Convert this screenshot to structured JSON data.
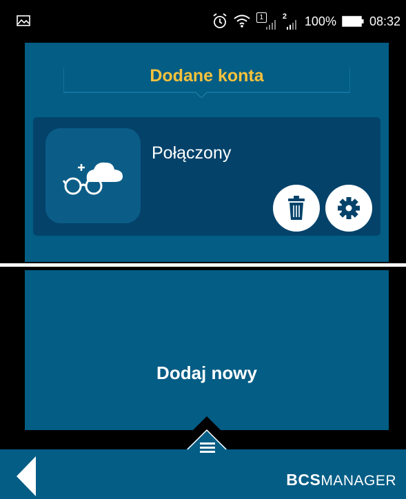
{
  "status_bar": {
    "battery": "100%",
    "time": "08:32",
    "sim1_badge": "1",
    "sim2_badge": "2",
    "icons": [
      "image-icon",
      "alarm-icon",
      "wifi-icon",
      "signal-icon",
      "signal-icon",
      "battery-icon"
    ]
  },
  "accounts": {
    "title": "Dodane konta",
    "items": [
      {
        "status": "Połączony",
        "icon": "cloud-glasses-icon"
      }
    ],
    "title_color": "#f6c23c"
  },
  "add_new": {
    "label": "Dodaj nowy"
  },
  "footer": {
    "logo_bold": "BCS",
    "logo_light": "MANAGER",
    "icons": [
      "back-arrow-icon",
      "hamburger-menu-icon"
    ]
  },
  "colors": {
    "panel": "#035d85",
    "card": "#04426a",
    "accent": "#f6c23c"
  }
}
